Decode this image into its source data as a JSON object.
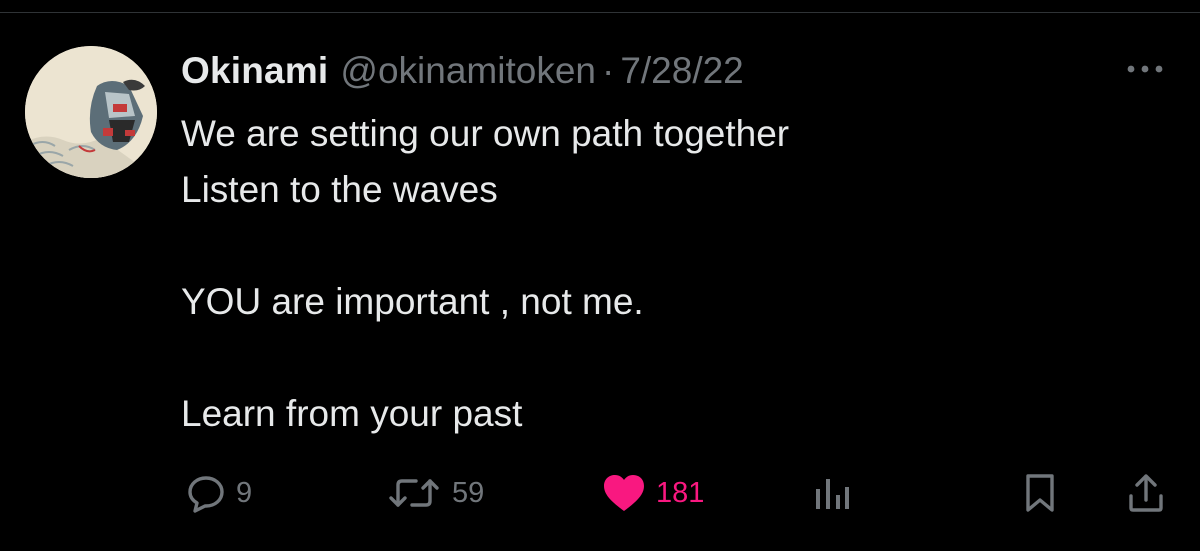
{
  "tweet": {
    "display_name": "Okinami",
    "handle": "@okinamitoken",
    "separator": "·",
    "date": "7/28/22",
    "text": "We are setting our own path together\nListen to the waves\n\nYOU are important , not me.\n\nLearn from your past",
    "avatar_icon": "ukiyo-e-avatar"
  },
  "actions": {
    "reply": {
      "icon": "reply-icon",
      "count": "9"
    },
    "retweet": {
      "icon": "retweet-icon",
      "count": "59"
    },
    "like": {
      "icon": "heart-icon",
      "count": "181",
      "active": true
    },
    "views": {
      "icon": "views-chart-icon"
    },
    "bookmark": {
      "icon": "bookmark-icon"
    },
    "share": {
      "icon": "share-icon"
    },
    "more": {
      "icon": "more-dots-icon"
    }
  },
  "colors": {
    "background": "#000000",
    "text_primary": "#e7e9ea",
    "text_secondary": "#71767b",
    "like_pink": "#f91880",
    "divider": "#2f3336"
  }
}
